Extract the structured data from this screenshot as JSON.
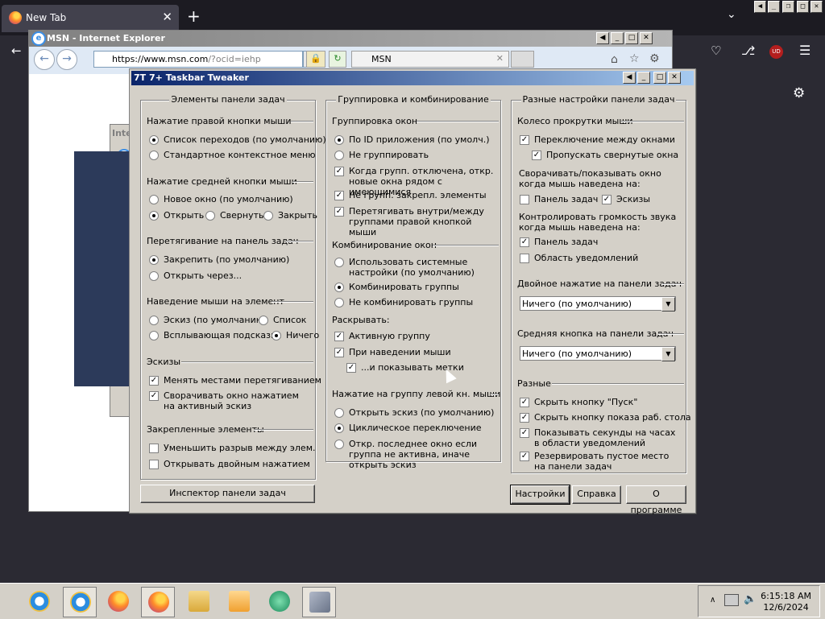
{
  "browser": {
    "tab_title": "New Tab",
    "new_tab": "+",
    "tab_close": "✕",
    "extension_badge": "UD"
  },
  "ie": {
    "title": "MSN - Internet Explorer",
    "address_prefix": "https://www.msn.com",
    "address_suffix": "/?ocid=iehp",
    "tab_title": "MSN",
    "background_label": "Inte"
  },
  "tweaker": {
    "title": "7+ Taskbar Tweaker",
    "col1": {
      "title": "Элементы панели задач",
      "right_click": {
        "label": "Нажатие правой кнопки мыши",
        "options": [
          "Список переходов (по умолчанию)",
          "Стандартное контекстное меню"
        ]
      },
      "middle_click": {
        "label": "Нажатие средней кнопки мыши",
        "options": [
          "Новое окно (по умолчанию)",
          "Открыть",
          "Свернуть",
          "Закрыть"
        ]
      },
      "drag": {
        "label": "Перетягивание на панель задач",
        "options": [
          "Закрепить (по умолчанию)",
          "Открыть через..."
        ]
      },
      "hover": {
        "label": "Наведение мыши на элемент",
        "options": [
          "Эскиз (по умолчанию)",
          "Список",
          "Всплывающая подсказка",
          "Ничего"
        ]
      },
      "thumbnails": {
        "label": "Эскизы",
        "options": [
          "Менять местами перетягиванием",
          "Сворачивать окно нажатием на активный эскиз"
        ]
      },
      "pinned": {
        "label": "Закрепленные элементы",
        "options": [
          "Уменьшить разрыв между элем.",
          "Открывать двойным нажатием"
        ]
      },
      "inspector_button": "Инспектор панели задач"
    },
    "col2": {
      "title": "Группировка и комбинирование",
      "grouping": {
        "label": "Группировка окон",
        "options": [
          "По ID приложения (по умолч.)",
          "Не группировать",
          "Когда групп. отключена, откр. новые окна рядом с имеющимися",
          "Не групп. закрепл. элементы",
          "Перетягивать внутри/между группами правой кнопкой мыши"
        ]
      },
      "combining": {
        "label": "Комбинирование окон",
        "options": [
          "Использовать системные настройки (по умолчанию)",
          "Комбинировать группы",
          "Не комбинировать группы"
        ]
      },
      "expand": {
        "label": "Раскрывать:",
        "options": [
          "Активную группу",
          "При наведении мыши",
          "...и показывать метки"
        ]
      },
      "left_click": {
        "label": "Нажатие на группу левой кн. мыши",
        "options": [
          "Открыть эскиз (по умолчанию)",
          "Циклическое переключение",
          "Откр. последнее окно если группа не активна, иначе открыть эскиз"
        ]
      }
    },
    "col3": {
      "title": "Разные настройки панели задач",
      "wheel": {
        "label": "Колесо прокрутки мыши",
        "options": [
          "Переключение между окнами",
          "Пропускать свернутые окна"
        ],
        "minimize_label": "Сворачивать/показывать окно когда мышь наведена на:",
        "minimize_options": [
          "Панель задач",
          "Эскизы"
        ],
        "volume_label": "Контролировать громкость звука когда мышь наведена на:",
        "volume_options": [
          "Панель задач",
          "Область уведомлений"
        ]
      },
      "double_click": {
        "label": "Двойное нажатие на панели задач",
        "value": "Ничего (по умолчанию)"
      },
      "middle_button": {
        "label": "Средняя кнопка на панели задач",
        "value": "Ничего (по умолчанию)"
      },
      "misc": {
        "label": "Разные",
        "options": [
          "Скрыть кнопку \"Пуск\"",
          "Скрыть кнопку показа раб. стола",
          "Показывать секунды на часах в области уведомлений",
          "Резервировать пустое место на панели задач"
        ]
      },
      "settings_button": "Настройки",
      "help_button": "Справка",
      "about_button": "О программе"
    }
  },
  "taskbar": {
    "time": "6:15:18 AM",
    "date": "12/6/2024"
  }
}
